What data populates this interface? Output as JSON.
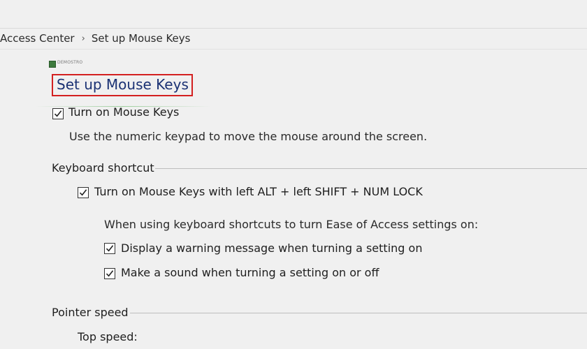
{
  "breadcrumb": {
    "parent": "Access Center",
    "separator": "›",
    "current": "Set up Mouse Keys"
  },
  "app_icon_text": "DEMOSTRO",
  "title": "Set up Mouse Keys",
  "turn_on": {
    "label": "Turn on Mouse Keys",
    "checked": true,
    "description": "Use the numeric keypad to move the mouse around the screen."
  },
  "keyboard_shortcut": {
    "heading": "Keyboard shortcut",
    "shortcut_label": "Turn on Mouse Keys with left ALT + left SHIFT + NUM LOCK",
    "shortcut_checked": true,
    "subheading": "When using keyboard shortcuts to turn Ease of Access settings on:",
    "warning_label": "Display a warning message when turning a setting on",
    "warning_checked": true,
    "sound_label": "Make a sound when turning a setting on or off",
    "sound_checked": true
  },
  "pointer_speed": {
    "heading": "Pointer speed",
    "top_speed_label": "Top speed:"
  },
  "colors": {
    "title_text": "#1a3173",
    "highlight_border": "#d32020",
    "background": "#f0f0f0"
  }
}
